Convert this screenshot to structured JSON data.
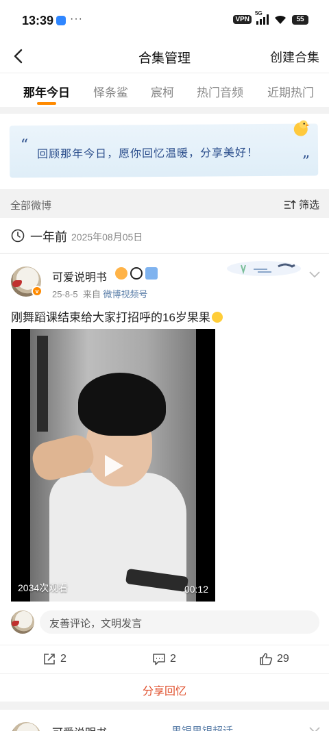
{
  "status_bar": {
    "time": "13:39",
    "dots": "···",
    "vpn": "VPN",
    "network": "5G",
    "battery": "55"
  },
  "nav": {
    "title": "合集管理",
    "action": "创建合集",
    "back_icon": "chevron-left-icon"
  },
  "tabs": [
    {
      "label": "那年今日",
      "active": true
    },
    {
      "label": "怿条鲨",
      "active": false
    },
    {
      "label": "宸柯",
      "active": false
    },
    {
      "label": "热门音频",
      "active": false
    },
    {
      "label": "近期热门",
      "active": false
    }
  ],
  "banner": {
    "text": "回顾那年今日，愿你回忆温暖，分享美好！",
    "quote_open": "“",
    "quote_close": "”"
  },
  "filter": {
    "label": "全部微博",
    "action": "筛选"
  },
  "date_section": {
    "relative": "一年前",
    "absolute": "2025年08月05日"
  },
  "post": {
    "username": "可爱说明书",
    "date": "25-8-5",
    "source_prefix": "来自",
    "source": "微博视频号",
    "text": "刚舞蹈课结束给大家打招呼的16岁果果",
    "video": {
      "views": "2034次观看",
      "duration": "00:12"
    },
    "comment_placeholder": "友善评论，文明发言",
    "reposts": "2",
    "comments": "2",
    "likes": "29",
    "share_memory": "分享回忆"
  },
  "next_post": {
    "username": "可爱说明书",
    "topic": "果银果银超话"
  },
  "colors": {
    "accent": "#ff8a00",
    "link": "#5a7ea8",
    "share": "#e0502d",
    "banner_text": "#2b4e8c"
  }
}
